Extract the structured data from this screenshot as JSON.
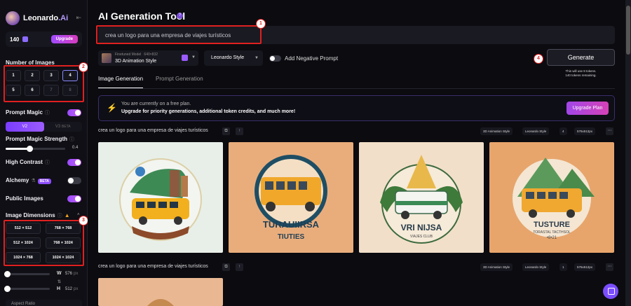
{
  "sidebar": {
    "brand": "Leonardo",
    "brand_suffix": ".Ai",
    "tokens": "140",
    "upgrade": "Upgrade",
    "num_images_label": "Number of Images",
    "num_options": [
      "1",
      "2",
      "3",
      "4",
      "5",
      "6",
      "7",
      "8"
    ],
    "selected_num": "4",
    "prompt_magic_label": "Prompt Magic",
    "prompt_magic_on": true,
    "versions": [
      "V2",
      "V3",
      "BETA"
    ],
    "strength_label": "Prompt Magic Strength",
    "strength_value": "0.4",
    "high_contrast_label": "High Contrast",
    "alchemy_label": "Alchemy",
    "alchemy_badge": "BETA",
    "public_images_label": "Public Images",
    "image_dimensions_label": "Image Dimensions",
    "dimensions": [
      "512 × 512",
      "768 × 768",
      "512 × 1024",
      "768 × 1024",
      "1024 × 768",
      "1024 × 1024"
    ],
    "width_label": "W",
    "width_value": "576",
    "height_label": "H",
    "height_value": "512",
    "px_unit": "px",
    "aspect_label": "Aspect Ratio"
  },
  "main": {
    "title": "AI Generation Tool",
    "prompt_value": "crea un logo para una empresa de viajes turísticos",
    "model_sub": "Finetuned Model",
    "model_size": "640×832",
    "model_name": "3D Animation Style",
    "style_select": "Leonardo Style",
    "negative_prompt_label": "Add Negative Prompt",
    "generate_label": "Generate",
    "generate_note_1": "This will use 8 tokens.",
    "generate_note_2": "140 tokens remaining.",
    "tabs": [
      "Image Generation",
      "Prompt Generation"
    ],
    "banner_line1": "You are currently on a free plan.",
    "banner_line2": "Upgrade for priority generations, additional token credits, and much more!",
    "banner_button": "Upgrade Plan"
  },
  "generations": [
    {
      "prompt": "crea un logo para una empresa de viajes turísticos",
      "chips": [
        "3D Animation Style",
        "Leonardo Style",
        "4",
        "576x512px"
      ]
    },
    {
      "prompt": "crea un logo para una empresa de viajes turísticos",
      "chips": [
        "3D Animation Style",
        "Leonardo Style",
        "1",
        "576x512px"
      ]
    }
  ],
  "image_texts": {
    "img2": "TURAUIIRSA",
    "img2b": "TIUTIES",
    "img3": "VRI NIJSA",
    "img3b": "VIAJES CLUB",
    "img4": "TUSTURE",
    "img4b": "TORASTAL TACTHSOL",
    "img4c": "•8•21"
  },
  "annotations": [
    "1",
    "2",
    "3",
    "4"
  ],
  "colors": {
    "accent": "#8c4dff",
    "highlight": "#e02020"
  }
}
